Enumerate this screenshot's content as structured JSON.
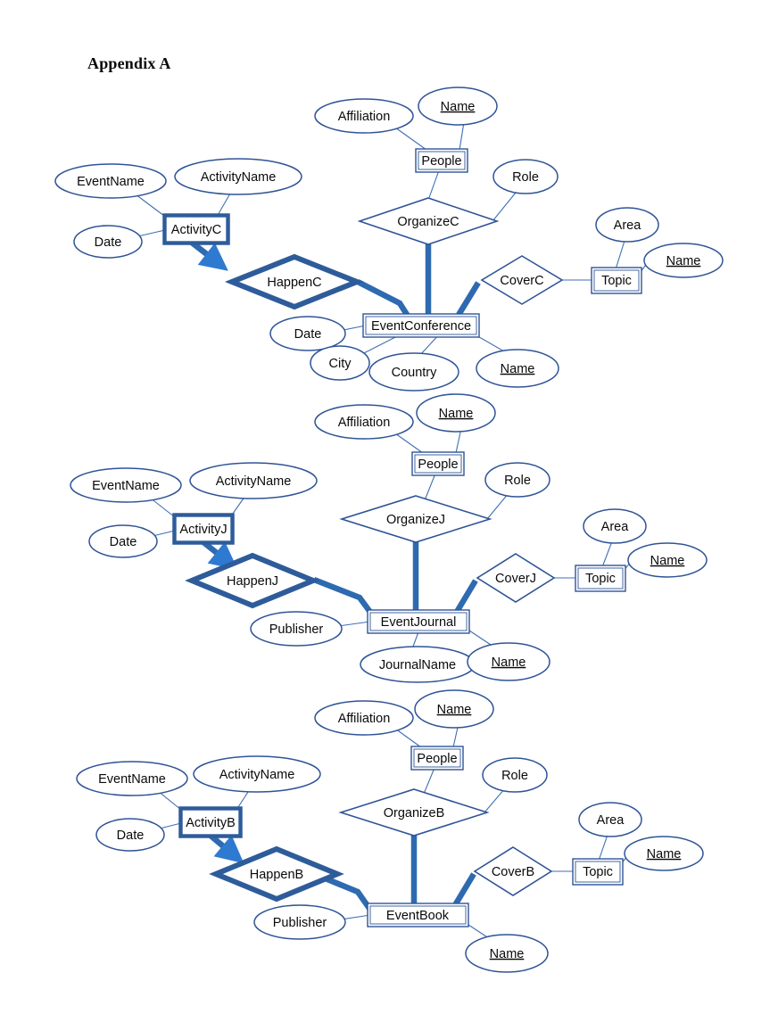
{
  "page": {
    "title": "Appendix A"
  },
  "colors": {
    "outline": "#2f5496",
    "thick_accent": "#2e5c9a",
    "thin_link": "#3f6fb5",
    "thick_link": "#2e6ab0",
    "text": "#0a0a0a",
    "background": "#ffffff"
  },
  "diagrams": [
    {
      "id": "conference",
      "entities": [
        {
          "name": "ActivityC",
          "weak": true
        },
        {
          "name": "EventConference",
          "weak": false
        },
        {
          "name": "People",
          "weak": false
        },
        {
          "name": "Topic",
          "weak": false
        }
      ],
      "relationships": [
        {
          "name": "HappenC",
          "identifying": true
        },
        {
          "name": "OrganizeC",
          "identifying": false
        },
        {
          "name": "CoverC",
          "identifying": false
        }
      ],
      "attributes": [
        {
          "name": "EventName",
          "owner": "ActivityC",
          "key": false
        },
        {
          "name": "ActivityName",
          "owner": "ActivityC",
          "key": false
        },
        {
          "name": "Date",
          "owner": "ActivityC",
          "key": false
        },
        {
          "name": "Affiliation",
          "owner": "People",
          "key": false
        },
        {
          "name": "Name",
          "owner": "People",
          "key": true
        },
        {
          "name": "Role",
          "owner": "OrganizeC",
          "key": false
        },
        {
          "name": "Date",
          "owner": "EventConference",
          "key": false
        },
        {
          "name": "City",
          "owner": "EventConference",
          "key": false
        },
        {
          "name": "Country",
          "owner": "EventConference",
          "key": false
        },
        {
          "name": "Name",
          "owner": "EventConference",
          "key": true
        },
        {
          "name": "Area",
          "owner": "Topic",
          "key": false
        },
        {
          "name": "Name",
          "owner": "Topic",
          "key": true
        }
      ]
    },
    {
      "id": "journal",
      "entities": [
        {
          "name": "ActivityJ",
          "weak": true
        },
        {
          "name": "EventJournal",
          "weak": false
        },
        {
          "name": "People",
          "weak": false
        },
        {
          "name": "Topic",
          "weak": false
        }
      ],
      "relationships": [
        {
          "name": "HappenJ",
          "identifying": true
        },
        {
          "name": "OrganizeJ",
          "identifying": false
        },
        {
          "name": "CoverJ",
          "identifying": false
        }
      ],
      "attributes": [
        {
          "name": "EventName",
          "owner": "ActivityJ",
          "key": false
        },
        {
          "name": "ActivityName",
          "owner": "ActivityJ",
          "key": false
        },
        {
          "name": "Date",
          "owner": "ActivityJ",
          "key": false
        },
        {
          "name": "Affiliation",
          "owner": "People",
          "key": false
        },
        {
          "name": "Name",
          "owner": "People",
          "key": true
        },
        {
          "name": "Role",
          "owner": "OrganizeJ",
          "key": false
        },
        {
          "name": "Publisher",
          "owner": "EventJournal",
          "key": false
        },
        {
          "name": "JournalName",
          "owner": "EventJournal",
          "key": false
        },
        {
          "name": "Name",
          "owner": "EventJournal",
          "key": true
        },
        {
          "name": "Area",
          "owner": "Topic",
          "key": false
        },
        {
          "name": "Name",
          "owner": "Topic",
          "key": true
        }
      ]
    },
    {
      "id": "book",
      "entities": [
        {
          "name": "ActivityB",
          "weak": true
        },
        {
          "name": "EventBook",
          "weak": false
        },
        {
          "name": "People",
          "weak": false
        },
        {
          "name": "Topic",
          "weak": false
        }
      ],
      "relationships": [
        {
          "name": "HappenB",
          "identifying": true
        },
        {
          "name": "OrganizeB",
          "identifying": false
        },
        {
          "name": "CoverB",
          "identifying": false
        }
      ],
      "attributes": [
        {
          "name": "EventName",
          "owner": "ActivityB",
          "key": false
        },
        {
          "name": "ActivityName",
          "owner": "ActivityB",
          "key": false
        },
        {
          "name": "Date",
          "owner": "ActivityB",
          "key": false
        },
        {
          "name": "Affiliation",
          "owner": "People",
          "key": false
        },
        {
          "name": "Name",
          "owner": "People",
          "key": true
        },
        {
          "name": "Role",
          "owner": "OrganizeB",
          "key": false
        },
        {
          "name": "Publisher",
          "owner": "EventBook",
          "key": false
        },
        {
          "name": "Name",
          "owner": "EventBook",
          "key": true
        },
        {
          "name": "Area",
          "owner": "Topic",
          "key": false
        },
        {
          "name": "Name",
          "owner": "Topic",
          "key": true
        }
      ]
    }
  ],
  "labels": {
    "d1": {
      "eventName": "EventName",
      "activityName": "ActivityName",
      "date": "Date",
      "activity": "ActivityC",
      "happen": "HappenC",
      "affiliation": "Affiliation",
      "peopleName": "Name",
      "people": "People",
      "organize": "OrganizeC",
      "role": "Role",
      "cover": "CoverC",
      "topic": "Topic",
      "area": "Area",
      "topicName": "Name",
      "event": "EventConference",
      "eventDate": "Date",
      "city": "City",
      "country": "Country",
      "eventNameKey": "Name"
    },
    "d2": {
      "eventName": "EventName",
      "activityName": "ActivityName",
      "date": "Date",
      "activity": "ActivityJ",
      "happen": "HappenJ",
      "affiliation": "Affiliation",
      "peopleName": "Name",
      "people": "People",
      "organize": "OrganizeJ",
      "role": "Role",
      "cover": "CoverJ",
      "topic": "Topic",
      "area": "Area",
      "topicName": "Name",
      "event": "EventJournal",
      "publisher": "Publisher",
      "journalName": "JournalName",
      "eventNameKey": "Name"
    },
    "d3": {
      "eventName": "EventName",
      "activityName": "ActivityName",
      "date": "Date",
      "activity": "ActivityB",
      "happen": "HappenB",
      "affiliation": "Affiliation",
      "peopleName": "Name",
      "people": "People",
      "organize": "OrganizeB",
      "role": "Role",
      "cover": "CoverB",
      "topic": "Topic",
      "area": "Area",
      "topicName": "Name",
      "event": "EventBook",
      "publisher": "Publisher",
      "eventNameKey": "Name"
    }
  }
}
